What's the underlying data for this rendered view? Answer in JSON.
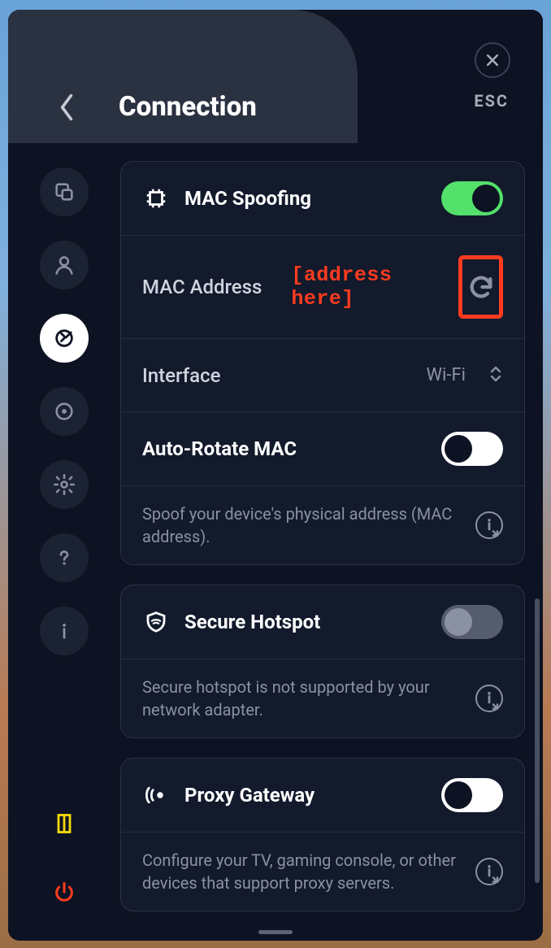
{
  "header": {
    "title": "Connection",
    "esc_label": "ESC"
  },
  "sidebar": {
    "items": [
      {
        "name": "overlap-icon"
      },
      {
        "name": "user-icon"
      },
      {
        "name": "plug-icon",
        "active": true
      },
      {
        "name": "target-icon"
      },
      {
        "name": "gear-icon"
      },
      {
        "name": "help-icon"
      },
      {
        "name": "info-icon"
      }
    ],
    "bottom_items": [
      {
        "name": "shield-yellow-icon"
      },
      {
        "name": "power-icon"
      }
    ]
  },
  "cards": {
    "mac": {
      "spoofing_label": "MAC Spoofing",
      "spoofing_on": true,
      "address_label": "MAC Address",
      "address_value": "[address here]",
      "interface_label": "Interface",
      "interface_value": "Wi-Fi",
      "auto_rotate_label": "Auto-Rotate MAC",
      "auto_rotate_on": false,
      "description": "Spoof your device's physical address (MAC address)."
    },
    "hotspot": {
      "label": "Secure Hotspot",
      "enabled": false,
      "description": "Secure hotspot is not supported by your network adapter."
    },
    "proxy": {
      "label": "Proxy Gateway",
      "enabled": false,
      "description": "Configure your TV, gaming console, or other devices that support proxy servers."
    }
  }
}
